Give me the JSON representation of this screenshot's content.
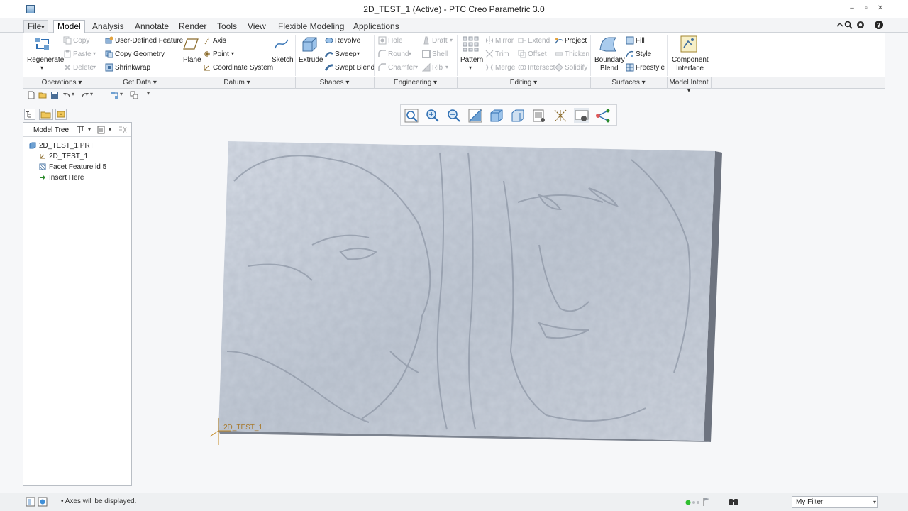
{
  "window": {
    "title": "2D_TEST_1 (Active) - PTC Creo Parametric 3.0"
  },
  "tabs": [
    {
      "label": "File",
      "arrow": "▾"
    },
    {
      "label": "Model"
    },
    {
      "label": "Analysis"
    },
    {
      "label": "Annotate"
    },
    {
      "label": "Render"
    },
    {
      "label": "Tools"
    },
    {
      "label": "View"
    },
    {
      "label": "Flexible Modeling"
    },
    {
      "label": "Applications"
    }
  ],
  "ribbon": {
    "operations": {
      "regenerate": "Regenerate",
      "copy": "Copy",
      "paste": "Paste",
      "delete": "Delete"
    },
    "get_data": {
      "udf": "User-Defined Feature",
      "copy_geometry": "Copy Geometry",
      "shrinkwrap": "Shrinkwrap"
    },
    "datum": {
      "plane": "Plane",
      "axis": "Axis",
      "point": "Point",
      "csys": "Coordinate System",
      "sketch": "Sketch"
    },
    "shapes": {
      "extrude": "Extrude",
      "revolve": "Revolve",
      "sweep": "Sweep",
      "swept_blend": "Swept Blend"
    },
    "engineering": {
      "hole": "Hole",
      "round": "Round",
      "chamfer": "Chamfer",
      "draft": "Draft",
      "shell": "Shell",
      "rib": "Rib"
    },
    "editing": {
      "pattern": "Pattern",
      "mirror": "Mirror",
      "trim": "Trim",
      "merge": "Merge",
      "extend": "Extend",
      "offset": "Offset",
      "intersect": "Intersect",
      "project": "Project",
      "thicken": "Thicken",
      "solidify": "Solidify"
    },
    "surfaces": {
      "boundary": "Boundary",
      "blend": "Blend",
      "fill": "Fill",
      "style": "Style",
      "freestyle": "Freestyle"
    },
    "model_intent": {
      "component": "Component",
      "interface": "Interface"
    },
    "groups": [
      "Operations",
      "Get Data",
      "Datum",
      "Shapes",
      "Engineering",
      "Editing",
      "Surfaces",
      "Model Intent"
    ]
  },
  "tree": {
    "header": "Model Tree",
    "items": [
      "2D_TEST_1.PRT",
      "2D_TEST_1",
      "Facet Feature id 5",
      "Insert Here"
    ]
  },
  "model": {
    "csys_label": "2D_TEST_1"
  },
  "status": {
    "message": "Axes will be displayed.",
    "filter": "My Filter"
  },
  "colors": {
    "accent": "#2f6fb3",
    "surface": "#c3cad6"
  }
}
